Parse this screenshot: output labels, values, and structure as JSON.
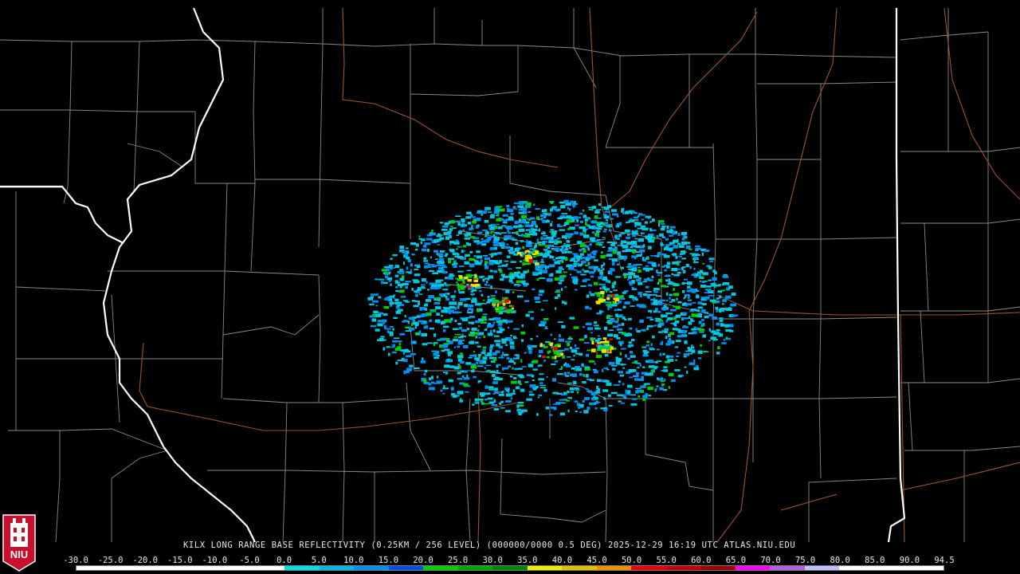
{
  "caption": "KILX LONG RANGE BASE REFLECTIVITY (0.25KM / 256 LEVEL) (000000/0000 0.5 DEG) 2025-12-29 16:19 UTC  ATLAS.NIU.EDU",
  "scale": {
    "labels": [
      "-30.0",
      "-25.0",
      "-20.0",
      "-15.0",
      "-10.0",
      "-5.0",
      "0.0",
      "5.0",
      "10.0",
      "15.0",
      "20.0",
      "25.0",
      "30.0",
      "35.0",
      "40.0",
      "45.0",
      "50.0",
      "55.0",
      "60.0",
      "65.0",
      "70.0",
      "75.0",
      "80.0",
      "85.0",
      "90.0",
      "94.5"
    ],
    "colors": [
      "#ffffff",
      "#ffffff",
      "#ffffff",
      "#ffffff",
      "#ffffff",
      "#ffffff",
      "#00e0e0",
      "#00b8e8",
      "#0090f0",
      "#0050e8",
      "#00d000",
      "#00a800",
      "#008800",
      "#f0f000",
      "#e0c000",
      "#f09000",
      "#f00000",
      "#c80000",
      "#a00000",
      "#ff00ff",
      "#b060e0",
      "#c0c0ff",
      "#ffffff",
      "#ffffff",
      "#ffffff"
    ]
  },
  "logo": {
    "text": "NIU",
    "colors": {
      "shield": "#c8102e",
      "tower": "#ffffff"
    }
  },
  "map": {
    "colors": {
      "state_border": "#ffffff",
      "county_border": "#8a8a8a",
      "highway": "#a0522d",
      "echo_weak": "#00c8e0",
      "echo_moderate": "#0090f0",
      "echo_strong": "#00d000",
      "echo_intense": "#f0e000",
      "echo_core": "#f00000"
    }
  }
}
